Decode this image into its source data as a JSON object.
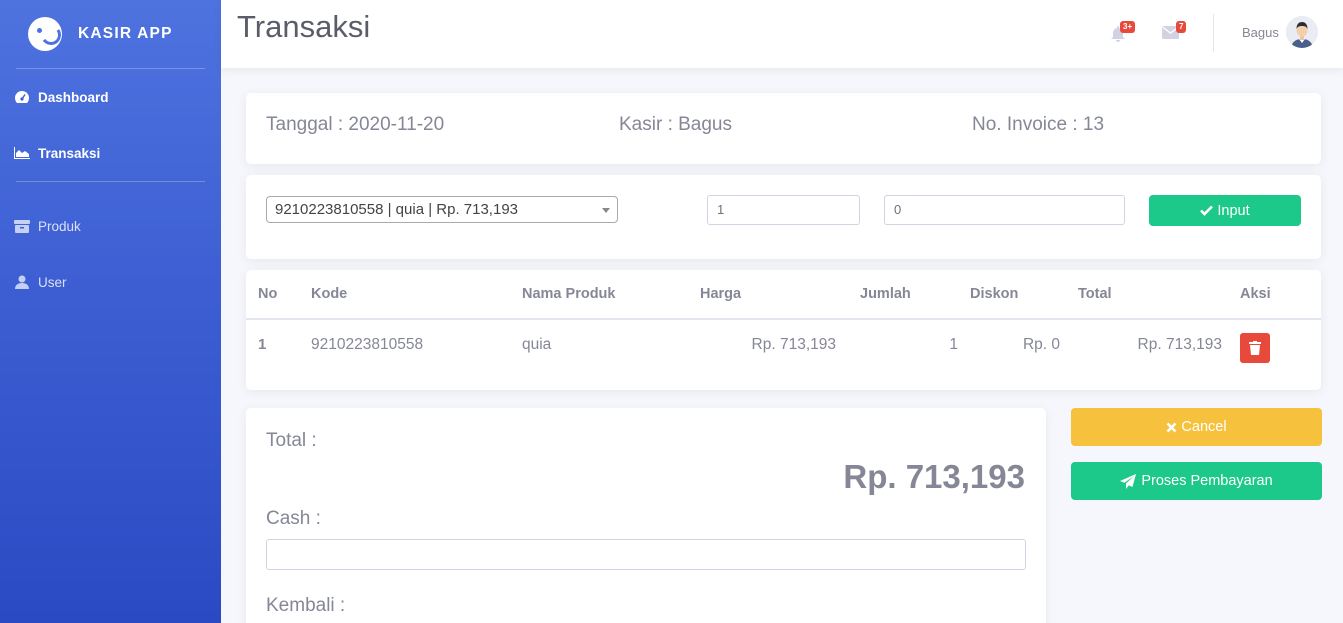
{
  "app": {
    "brand": "KASIR APP"
  },
  "sidebar": {
    "items": [
      {
        "label": "Dashboard",
        "icon": "tachometer-icon",
        "active": true
      },
      {
        "label": "Transaksi",
        "icon": "area-chart-icon",
        "active": true
      },
      {
        "label": "Produk",
        "icon": "box-icon",
        "active": false
      },
      {
        "label": "User",
        "icon": "user-icon",
        "active": false
      }
    ]
  },
  "topbar": {
    "title": "Transaksi",
    "alerts_badge": "3+",
    "messages_badge": "7",
    "username": "Bagus"
  },
  "info": {
    "tanggal": "Tanggal : 2020-11-20",
    "kasir": "Kasir : Bagus",
    "invoice": "No. Invoice : 13"
  },
  "form": {
    "product_select": "9210223810558 | quia | Rp. 713,193",
    "qty": "1",
    "discount": "0",
    "input_label": "Input"
  },
  "table": {
    "headers": [
      "No",
      "Kode",
      "Nama Produk",
      "Harga",
      "Jumlah",
      "Diskon",
      "Total",
      "Aksi"
    ],
    "rows": [
      {
        "no": "1",
        "kode": "9210223810558",
        "nama": "quia",
        "harga": "Rp. 713,193",
        "jumlah": "1",
        "diskon": "Rp. 0",
        "total": "Rp. 713,193"
      }
    ]
  },
  "summary": {
    "total_label": "Total :",
    "total_value": "Rp. 713,193",
    "cash_label": "Cash :",
    "cash_value": "",
    "kembali_label": "Kembali :"
  },
  "actions": {
    "cancel_label": "Cancel",
    "process_label": "Proses Pembayaran"
  },
  "colors": {
    "primary": "#4e73df",
    "success": "#1cc88a",
    "warning": "#f6c23e",
    "danger": "#e74a3b"
  }
}
